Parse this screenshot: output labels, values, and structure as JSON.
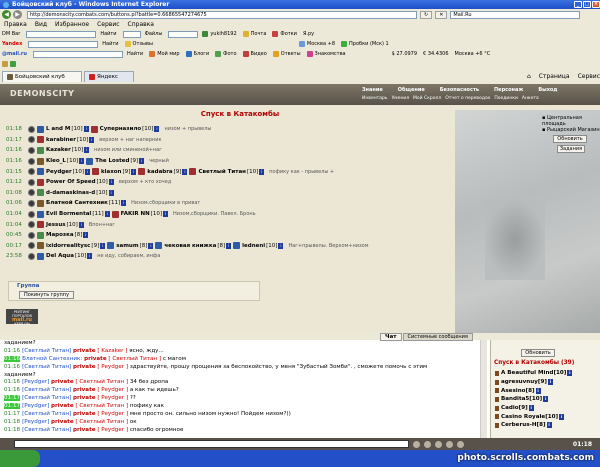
{
  "window": {
    "title": "Бойцовский клуб - Windows Internet Explorer"
  },
  "address": {
    "url": "http://demonscity.combats.com/buttons.pl?battle=0.66865547274675",
    "search_placeholder": "Mail.Ru"
  },
  "menu": [
    "Правка",
    "Вид",
    "Избранное",
    "Сервис",
    "Справка"
  ],
  "toolbar1": {
    "left": "DM Bar",
    "find": "Найти",
    "files": "Файлы",
    "user": "yukih8192",
    "mail": "Почта",
    "photos": "Фотки",
    "ya": "Я.ру"
  },
  "toolbar2": {
    "yandex": "Yandex",
    "find": "Найти",
    "reviews": "Отзывы",
    "moscow": "Москва +8",
    "traffic": "Пробки (Мск) 1"
  },
  "toolbar3": {
    "mailru": "@mail.ru",
    "find": "Найти",
    "world": "Мой мир",
    "blogs": "Блоги",
    "photo": "Фото",
    "video": "Видео",
    "answers": "Ответы",
    "dating": "Знакомства",
    "rate1": "$ 27.0979",
    "rate2": "€ 34.4306",
    "weather": "Москва +6 °C"
  },
  "tabs": [
    {
      "label": "Бойцовский клуб"
    },
    {
      "label": "Яндекс"
    }
  ],
  "tabs_right": {
    "page": "Страница",
    "service": "Сервис"
  },
  "game": {
    "logo": "DEMONSCITY",
    "topmenu": [
      "Знание",
      "Общение",
      "Безопасность",
      "Персонаж",
      "Выход"
    ],
    "submenu": [
      "Инвентарь",
      "Умения",
      "Мой Скролл",
      "Отчет о переводах",
      "Поединки",
      "Анкета"
    ],
    "room_title": "Спуск в Катакомбы",
    "locations": [
      "Центральная площадь",
      "Рыцарский Магазин"
    ],
    "btn_refresh": "Обновить",
    "btn_tasks": "Задания",
    "players": [
      {
        "time": "01:18",
        "name": "L and M",
        "level": "[10]",
        "extra": "Суперназило",
        "extra_level": "[10]",
        "status": "низом + прывелы"
      },
      {
        "time": "01:17",
        "name": "karabiner",
        "level": "[10]",
        "status": "верхом + наг наперник"
      },
      {
        "time": "01:16",
        "name": "Kazaker",
        "level": "[10]",
        "status": "низом или сминеной+наг"
      },
      {
        "time": "01:16",
        "name": "Kleo_L",
        "level": "[10]",
        "extra": "The Losted",
        "extra_level": "[9]",
        "status": "черный"
      },
      {
        "time": "01:15",
        "name": "Peydger",
        "level": "[10]",
        "extra": "klaxon",
        "extra_level": "[9]",
        "extra2": "kadabra",
        "extra2_level": "[9]",
        "extra3": "Светлый Титан",
        "extra3_level": "[10]",
        "status": "пофику как - прывелы +"
      },
      {
        "time": "01:12",
        "name": "Power Of Speed",
        "level": "[10]",
        "status": "верхом + кто хочед"
      },
      {
        "time": "01:08",
        "name": "d-damaskinas-d",
        "level": "[10]"
      },
      {
        "time": "01:06",
        "name": "Блатной Сантехник",
        "level": "[11]",
        "status": "Низом.сборщики в приват"
      },
      {
        "time": "01:04",
        "name": "Evil Bormental",
        "level": "[11]",
        "extra": "FAKIR NN",
        "extra_level": "[10]",
        "status": "Низом,сборщики. Павел. Бронь"
      },
      {
        "time": "01:04",
        "name": "Jessus",
        "level": "[10]",
        "status": "Впон+наг"
      },
      {
        "time": "00:45",
        "name": "Марозка",
        "level": "[8]"
      },
      {
        "time": "00:17",
        "name": "ixidorrealitysc",
        "level": "[9]",
        "extra": "samum",
        "extra_level": "[8]",
        "extra2": "чековая книжка",
        "extra2_level": "[8]",
        "extra3": "ledneni",
        "extra3_level": "[10]",
        "status": "Наг+прывелы. Верхом+низом"
      },
      {
        "time": "23:58",
        "name": "Del Aqua",
        "level": "[10]",
        "status": "не иду, собираем, инфа"
      }
    ],
    "group": {
      "title": "Группа",
      "button": "Покинуть группу"
    },
    "badge": {
      "line1": "РЕЙТИНГ ПОРТАЛОВ",
      "line2": "mail.ru",
      "line3": "KEEP ON"
    }
  },
  "chat": {
    "tabs": [
      "Чат",
      "Системные сообщения"
    ],
    "lines": [
      {
        "time": "",
        "nick": "",
        "priv": "",
        "to": "",
        "text": "заданием?"
      },
      {
        "time": "01:16",
        "nick": "[Светлый Титан]",
        "priv": "private",
        "to": "[ Kazaker ]",
        "text": "ясно, жду..."
      },
      {
        "time": "01:16",
        "hl": true,
        "nick": "Блатной Сантехник:",
        "priv": "private",
        "to": "[ Светлый Титан ]",
        "text": "с магом"
      },
      {
        "time": "01:16",
        "nick": "[Светлый Титан]",
        "priv": "private",
        "to": "[ Peydger ]",
        "text": "здраствуйте, прошу прощения за беспокойство, у меня \"Зубастый Зомби\". , сможете помочь с этим"
      },
      {
        "time": "",
        "nick": "",
        "priv": "",
        "to": "",
        "text": "заданием?"
      },
      {
        "time": "01:16",
        "nick": "[Peydger]",
        "priv": "private",
        "to": "[ Светлый Титан ]",
        "text": "34 без дропа"
      },
      {
        "time": "01:16",
        "nick": "[Светлый Титан]",
        "priv": "private",
        "to": "[ Peydger ]",
        "text": "а как ты идешь?"
      },
      {
        "time": "01:17",
        "hl": true,
        "nick": "[Светлый Титан]",
        "priv": "private",
        "to": "[ Peydger ]",
        "text": "??"
      },
      {
        "time": "01:17",
        "hl": true,
        "nick": "[Peydger]",
        "priv": "private",
        "to": "[ Светлый Титан ]",
        "text": "пофику как"
      },
      {
        "time": "01:17",
        "nick": "[Светлый Титан]",
        "priv": "private",
        "to": "[ Peydger ]",
        "text": "мне просто он. сильно низом нужно! Пойдем низом?))"
      },
      {
        "time": "01:18",
        "nick": "[Peydger]",
        "priv": "private",
        "to": "[ Светлый Титан ]",
        "text": "ок"
      },
      {
        "time": "01:18",
        "nick": "[Светлый Титан]",
        "priv": "private",
        "to": "[ Peydger ]",
        "text": "спасибо огромное"
      }
    ]
  },
  "online": {
    "button": "Обновить",
    "title": "Спуск в Катакомбы (39)",
    "users": [
      {
        "name": "A Beautiful Mind",
        "level": "[10]"
      },
      {
        "name": "agresuvnuy",
        "level": "[9]"
      },
      {
        "name": "Asesino",
        "level": "[8]"
      },
      {
        "name": "Bandita5",
        "level": "[10]"
      },
      {
        "name": "Cadio",
        "level": "[9]"
      },
      {
        "name": "Casino Royale",
        "level": "[10]"
      },
      {
        "name": "Cerberus-H",
        "level": "[8]"
      }
    ]
  },
  "bottom": {
    "clock": "01:18"
  },
  "watermark": "photo.scrolls.combats.com",
  "colors": {
    "ie_blue": "#2350c8",
    "title_red": "#b00000",
    "nick_blue": "#1e50c8",
    "private_red": "#c00000",
    "time_green": "#2a7a2a"
  }
}
